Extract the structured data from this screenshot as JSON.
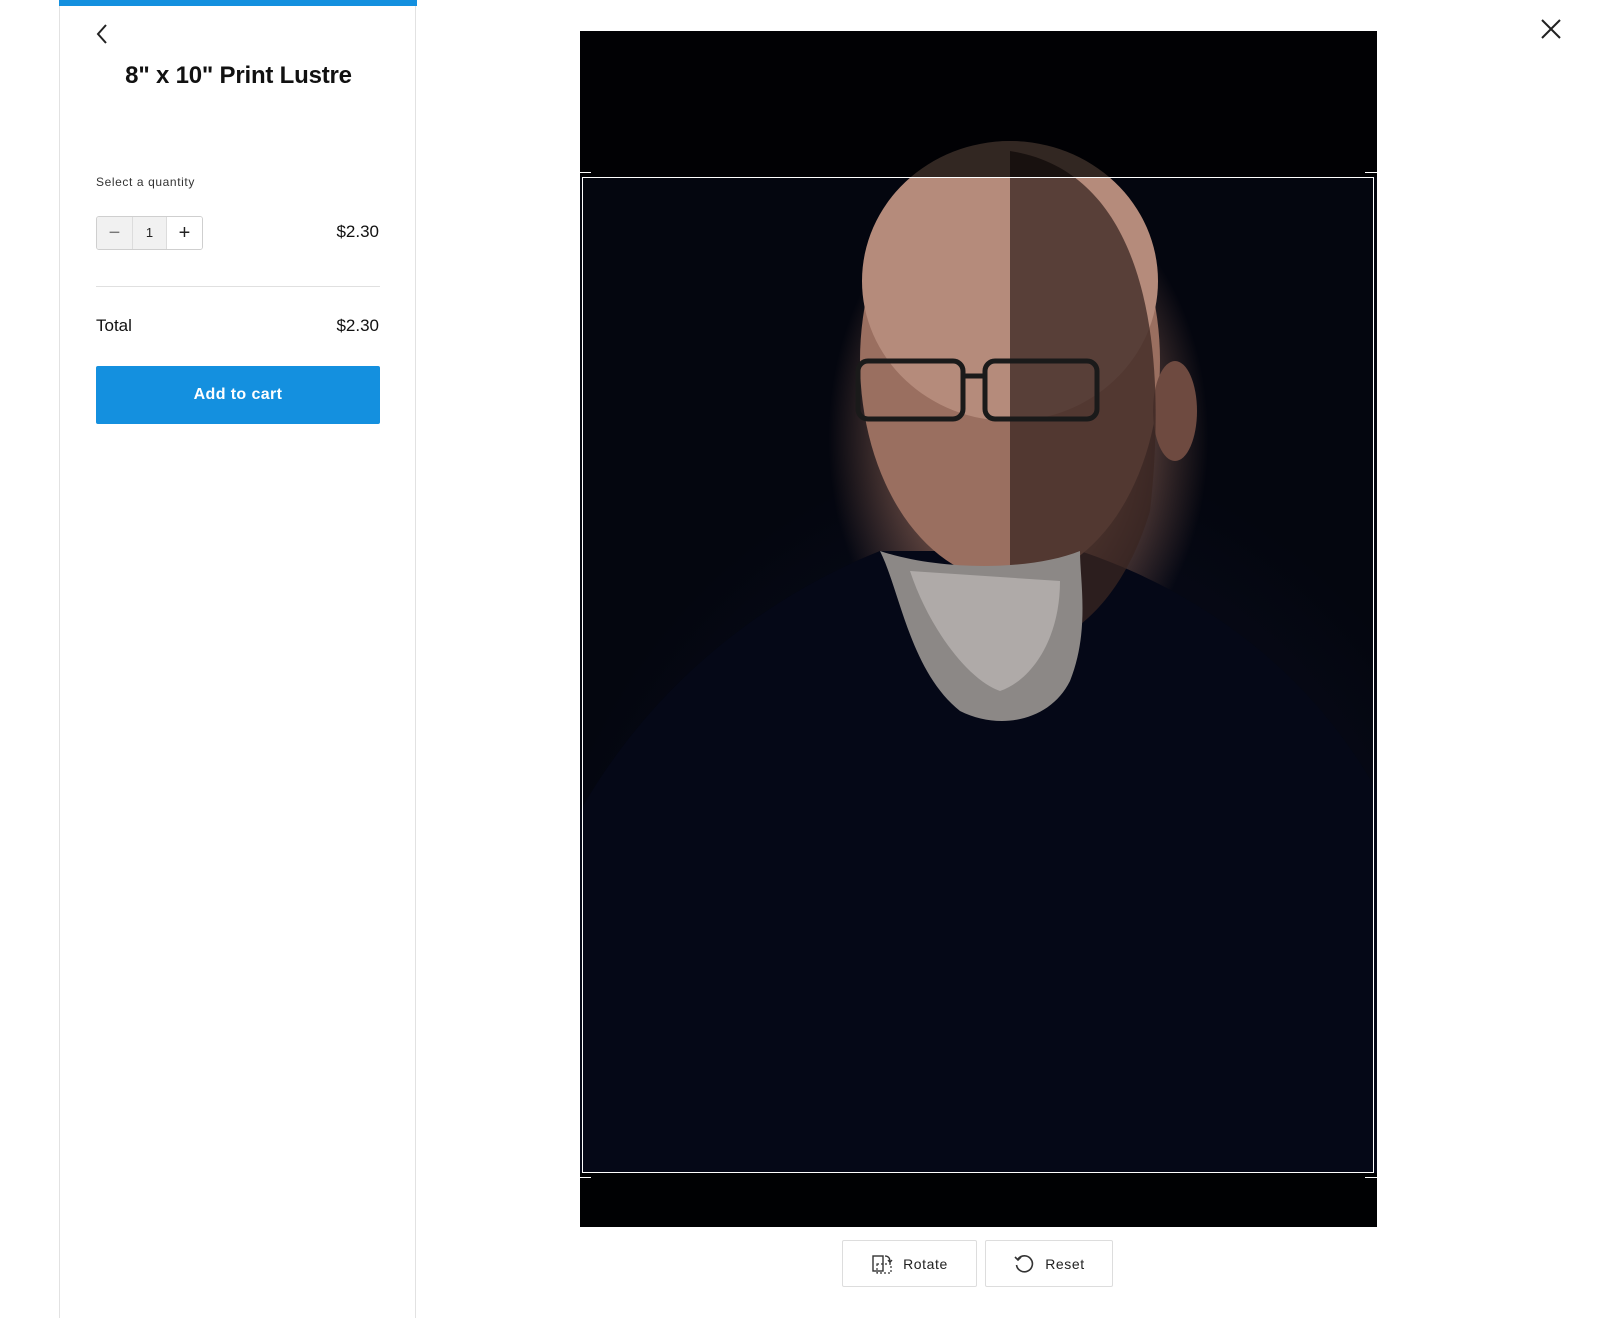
{
  "panel": {
    "back_icon": "chevron-left-icon",
    "title": "8\" x 10\" Print Lustre",
    "quantity_label": "Select a quantity",
    "quantity": {
      "minus_label": "−",
      "value": "1",
      "plus_label": "+"
    },
    "unit_price": "$2.30",
    "total_label": "Total",
    "total_value": "$2.30",
    "add_to_cart_label": "Add to cart",
    "accent_color": "#1490df"
  },
  "close_icon": "close-icon",
  "editor": {
    "rotate_icon": "rotate-icon",
    "rotate_label": "Rotate",
    "reset_icon": "reset-icon",
    "reset_label": "Reset"
  }
}
